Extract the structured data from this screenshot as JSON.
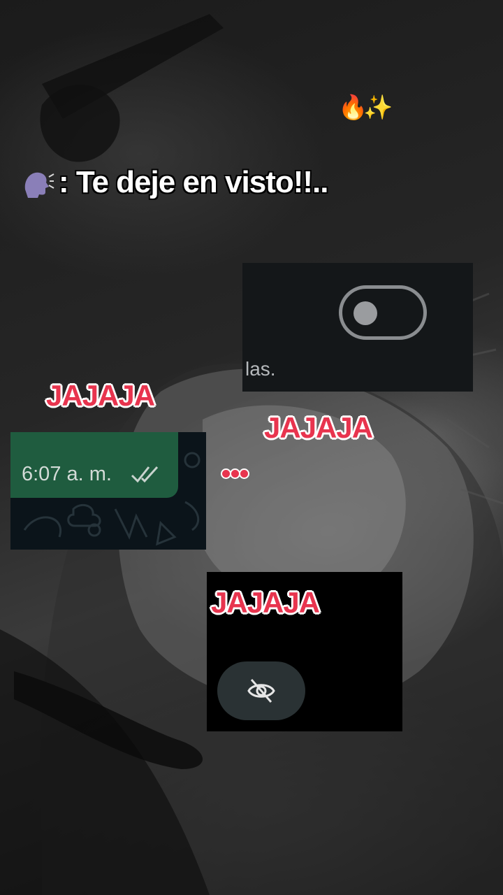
{
  "caption": {
    "head_icon": "speaking-head-icon",
    "text": ": Te deje en visto!!.."
  },
  "top_emoji": "🔥✨",
  "laugh_labels": [
    "JAJAJA",
    "JAJAJA",
    "JAJAJA"
  ],
  "toggle_screenshot": {
    "toggle_state": "off",
    "partial_text": "las.",
    "partial_text_2": "..."
  },
  "chat_screenshot": {
    "time": "6:07 a. m.",
    "status_icon": "double-check-icon",
    "bubble_color": "#1f5c3f"
  },
  "eye_screenshot": {
    "icon": "eye-off-icon",
    "button_color": "#2a3234"
  },
  "dots_icon": "ellipsis-icon",
  "colors": {
    "laugh_text": "#e8344e",
    "laugh_outline": "#ffffff"
  }
}
